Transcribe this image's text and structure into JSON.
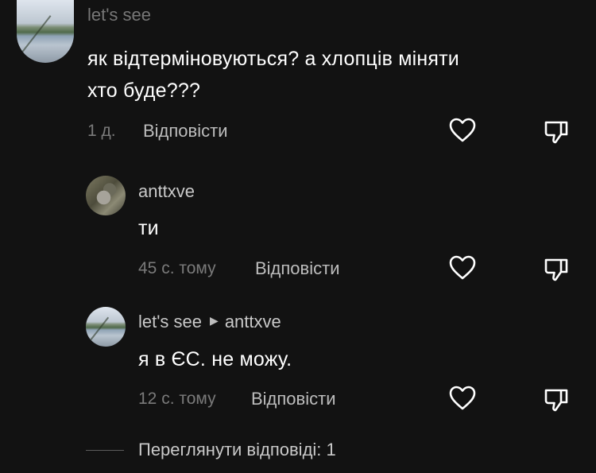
{
  "comments": [
    {
      "username": "let's see",
      "text_line1": "як відтерміновуються? а хлопців міняти",
      "text_line2": "хто буде???",
      "time": "1 д.",
      "reply_label": "Відповісти"
    },
    {
      "username": "anttxve",
      "text": "ти",
      "time": "45 с. тому",
      "reply_label": "Відповісти"
    },
    {
      "username": "let's see",
      "reply_to": "anttxve",
      "text": "я в ЄС. не можу.",
      "time": "12 с. тому",
      "reply_label": "Відповісти"
    }
  ],
  "view_replies": "Переглянути відповіді: 1",
  "icons": {
    "like": "heart-icon",
    "dislike": "thumbs-down-icon",
    "reply_arrow": "caret-right-icon"
  },
  "colors": {
    "background": "#121212",
    "text": "#ffffff",
    "muted": "#7a7a7a"
  }
}
